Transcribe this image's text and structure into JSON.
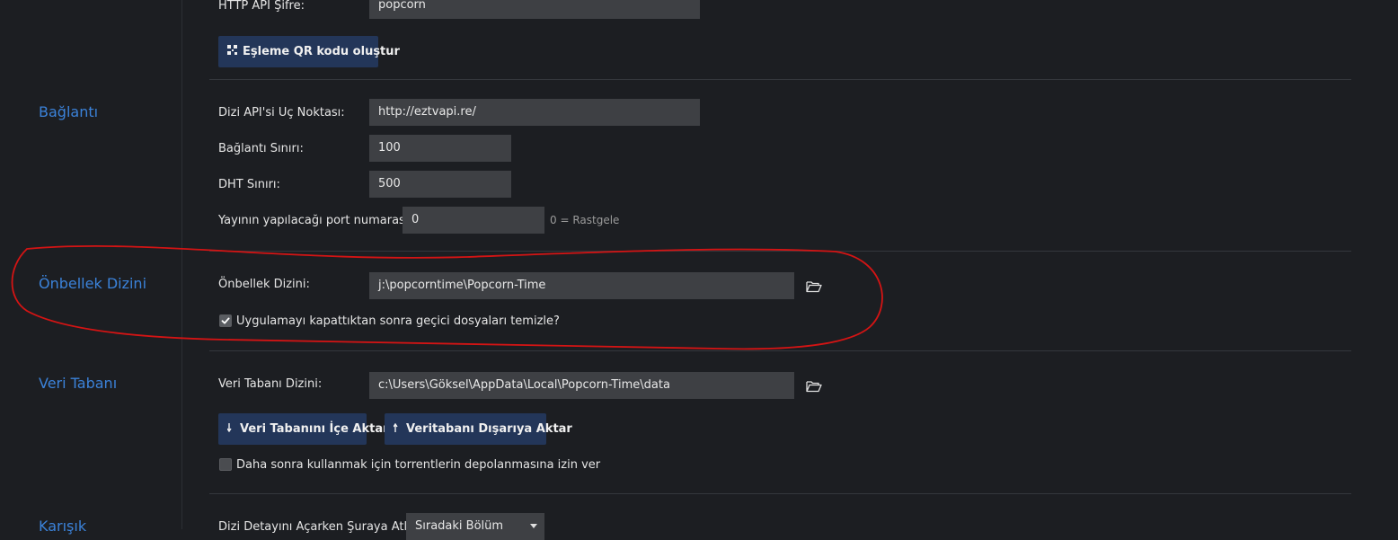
{
  "sections": {
    "baglanti": "Bağlantı",
    "onbellek": "Önbellek Dizini",
    "veri_tabani": "Veri Tabanı",
    "karisik": "Karışık"
  },
  "http_api": {
    "password_label": "HTTP API Şifre:",
    "password_value": "popcorn",
    "qr_button": "Eşleme QR kodu oluştur"
  },
  "connection": {
    "endpoint_label": "Dizi API'si Uç Noktası:",
    "endpoint_value": "http://eztvapi.re/",
    "limit_label": "Bağlantı Sınırı:",
    "limit_value": "100",
    "dht_label": "DHT Sınırı:",
    "dht_value": "500",
    "port_label": "Yayının yapılacağı port numarası:",
    "port_value": "0",
    "port_hint": "0 = Rastgele"
  },
  "cache": {
    "dir_label": "Önbellek Dizini:",
    "dir_value": "j:\\popcorntime\\Popcorn-Time",
    "clear_label": "Uygulamayı kapattıktan sonra geçici dosyaları temizle?",
    "clear_checked": true
  },
  "database": {
    "dir_label": "Veri Tabanı Dizini:",
    "dir_value": "c:\\Users\\Göksel\\AppData\\Local\\Popcorn-Time\\data",
    "import_button": "Veri Tabanını İçe Aktar",
    "export_button": "Veritabanı Dışarıya Aktar",
    "store_label": "Daha sonra kullanmak için torrentlerin depolanmasına izin ver",
    "store_checked": false
  },
  "misc": {
    "skip_label": "Dizi Detayını Açarken Şuraya Atla:",
    "skip_value": "Sıradaki Bölüm"
  },
  "colors": {
    "background": "#1c1e22",
    "accent": "#3b82d9",
    "button": "#233659",
    "input": "#3e4044",
    "annotation": "#d41414"
  }
}
